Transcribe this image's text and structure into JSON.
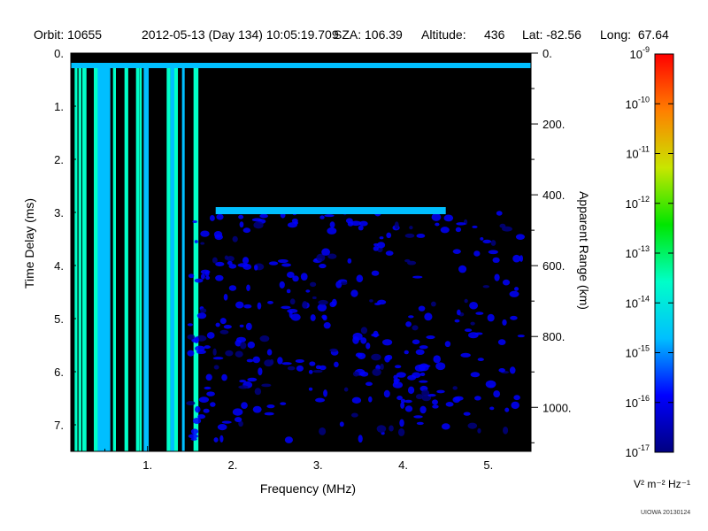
{
  "header": {
    "orbit": "Orbit: 10655",
    "datetime": "2012-05-13 (Day 134) 10:05:19.709",
    "sza": "SZA: 106.39",
    "altitude_label": "Altitude:",
    "altitude_value": "436",
    "lat": "Lat: -82.56",
    "long": "Long:  67.64"
  },
  "chart_data": {
    "type": "heatmap",
    "xlabel": "Frequency (MHz)",
    "ylabel": "Time Delay (ms)",
    "y2label": "Apparent Range (km)",
    "xlim": [
      0.1,
      5.5
    ],
    "ylim": [
      7.5,
      0
    ],
    "x_ticks": [
      {
        "value": 1,
        "label": "1."
      },
      {
        "value": 2,
        "label": "2."
      },
      {
        "value": 3,
        "label": "3."
      },
      {
        "value": 4,
        "label": "4."
      },
      {
        "value": 5,
        "label": "5."
      }
    ],
    "y_ticks": [
      {
        "value": 0,
        "label": "0."
      },
      {
        "value": 1,
        "label": "1."
      },
      {
        "value": 2,
        "label": "2."
      },
      {
        "value": 3,
        "label": "3."
      },
      {
        "value": 4,
        "label": "4."
      },
      {
        "value": 5,
        "label": "5."
      },
      {
        "value": 6,
        "label": "6."
      },
      {
        "value": 7,
        "label": "7."
      }
    ],
    "range_ticks": [
      {
        "range_km": 0,
        "label": "0."
      },
      {
        "range_km": 200,
        "label": "200."
      },
      {
        "range_km": 400,
        "label": "400."
      },
      {
        "range_km": 600,
        "label": "600."
      },
      {
        "range_km": 800,
        "label": "800."
      },
      {
        "range_km": 1000,
        "label": "1000."
      }
    ],
    "colorbar": {
      "log_min": -17,
      "log_max": -9,
      "ticks": [
        -17,
        -16,
        -15,
        -14,
        -13,
        -12,
        -11,
        -10,
        -9
      ],
      "tick_base": "10",
      "units_label": "V² m⁻² Hz⁻¹",
      "colors": [
        "#000080",
        "#0000ff",
        "#00bfff",
        "#00ffc8",
        "#00e600",
        "#c8e600",
        "#ff8000",
        "#ff0000"
      ]
    },
    "features": [
      {
        "name": "surface/plasma echo",
        "delay_ms_start": 0.25,
        "freq_start": 0.1,
        "freq_end": 5.5
      },
      {
        "name": "ground echo",
        "delay_ms_start": 2.95,
        "freq_start": 1.8,
        "freq_end": 4.5
      },
      {
        "name": "low-frequency streaks",
        "freq_start": 0.1,
        "freq_end": 1.7
      }
    ],
    "background": "#000000"
  },
  "footer": {
    "credit": "UIOWA 20130124"
  }
}
